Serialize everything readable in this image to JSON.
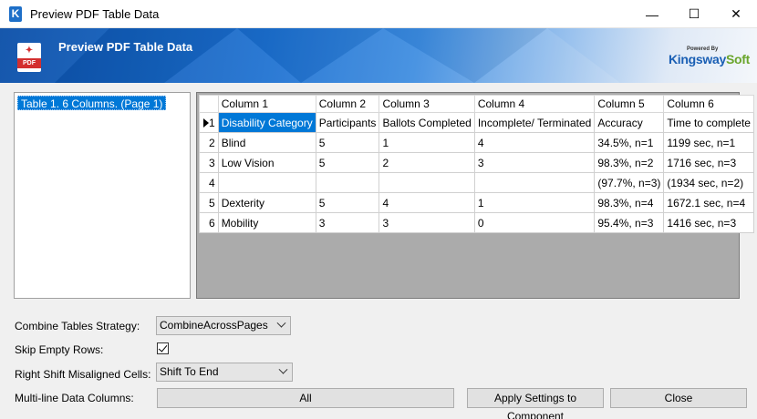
{
  "window": {
    "title": "Preview PDF Table Data",
    "minimize_glyph": "—",
    "maximize_glyph": "☐",
    "close_glyph": "✕"
  },
  "banner": {
    "title": "Preview PDF Table Data",
    "pdf_icon_label": "PDF",
    "brand_powered": "Powered By",
    "brand_name_part1": "Kingsway",
    "brand_name_part2": "Soft"
  },
  "tree": {
    "items": [
      {
        "label": "Table 1. 6 Columns. (Page 1)"
      }
    ]
  },
  "grid": {
    "columns": [
      "Column 1",
      "Column 2",
      "Column 3",
      "Column 4",
      "Column 5",
      "Column 6"
    ],
    "rows": [
      {
        "num": "1",
        "cells": [
          "Disability Category",
          "Participants",
          "Ballots Completed",
          "Incomplete/ Terminated",
          "Accuracy",
          "Time to complete"
        ]
      },
      {
        "num": "2",
        "cells": [
          "Blind",
          "5",
          "1",
          "4",
          "34.5%, n=1",
          "1199 sec, n=1"
        ]
      },
      {
        "num": "3",
        "cells": [
          "Low Vision",
          "5",
          "2",
          "3",
          "98.3%, n=2",
          "1716 sec, n=3"
        ]
      },
      {
        "num": "4",
        "cells": [
          "",
          "",
          "",
          "",
          "(97.7%, n=3)",
          "(1934 sec, n=2)"
        ]
      },
      {
        "num": "5",
        "cells": [
          "Dexterity",
          "5",
          "4",
          "1",
          "98.3%, n=4",
          "1672.1 sec, n=4"
        ]
      },
      {
        "num": "6",
        "cells": [
          "Mobility",
          "3",
          "3",
          "0",
          "95.4%, n=3",
          "1416 sec, n=3"
        ]
      }
    ]
  },
  "settings": {
    "combine_label": "Combine Tables Strategy:",
    "combine_value": "CombineAcrossPages",
    "skip_empty_label": "Skip Empty Rows:",
    "skip_empty_checked": true,
    "right_shift_label": "Right Shift Misaligned Cells:",
    "right_shift_value": "Shift To End",
    "multiline_label": "Multi-line Data Columns:",
    "multiline_value": "All"
  },
  "buttons": {
    "apply": "Apply Settings to Component",
    "close": "Close"
  },
  "colors": {
    "selection": "#0078d7",
    "banner_blue": "#1b6fd0",
    "pdf_red": "#d32f2f",
    "brand_blue": "#1a5fb4",
    "brand_green": "#6aa52c"
  }
}
